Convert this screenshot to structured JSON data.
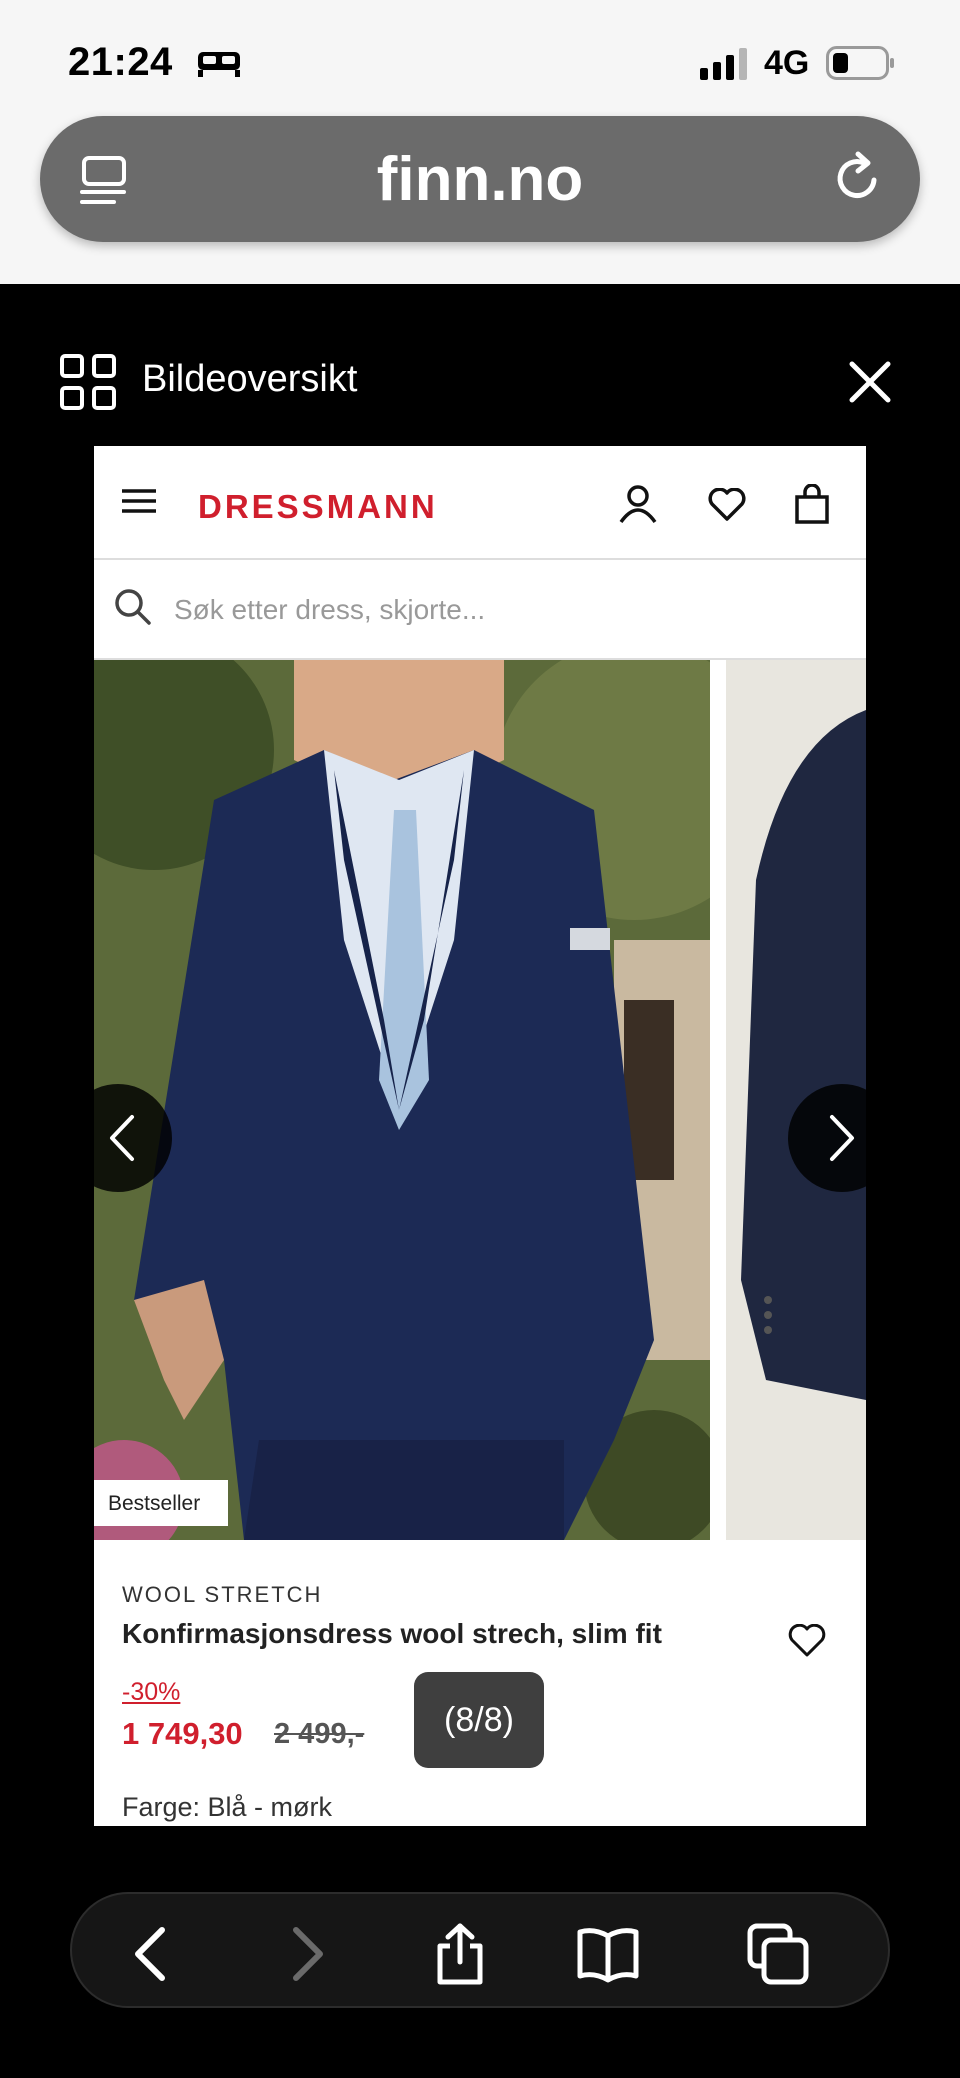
{
  "status_bar": {
    "time": "21:24",
    "network": "4G"
  },
  "browser": {
    "url": "finn.no"
  },
  "overlay": {
    "title": "Bildeoversikt",
    "counter": "(8/8)"
  },
  "shop": {
    "brand": "DRESSMANN",
    "search_placeholder": "Søk etter dress, skjorte..."
  },
  "product": {
    "badge": "Bestseller",
    "subtitle": "WOOL STRETCH",
    "title": "Konfirmasjonsdress wool strech, slim fit",
    "discount": "-30%",
    "price": "1 749,30",
    "old_price": "2 499,-",
    "color": "Farge: Blå - mørk"
  },
  "icons": [
    "bed-icon",
    "signal-icon",
    "battery-icon",
    "reader-icon",
    "reload-icon",
    "grid-icon",
    "close-icon",
    "hamburger-icon",
    "user-icon",
    "heart-icon",
    "bag-icon",
    "search-icon",
    "chevron-left-icon",
    "chevron-right-icon",
    "back-icon",
    "forward-icon",
    "share-icon",
    "bookmarks-icon",
    "tabs-icon"
  ],
  "colors": {
    "brand_red": "#d01f2d",
    "suit_navy": "#1c2a55",
    "overlay_bg": "#000000"
  }
}
